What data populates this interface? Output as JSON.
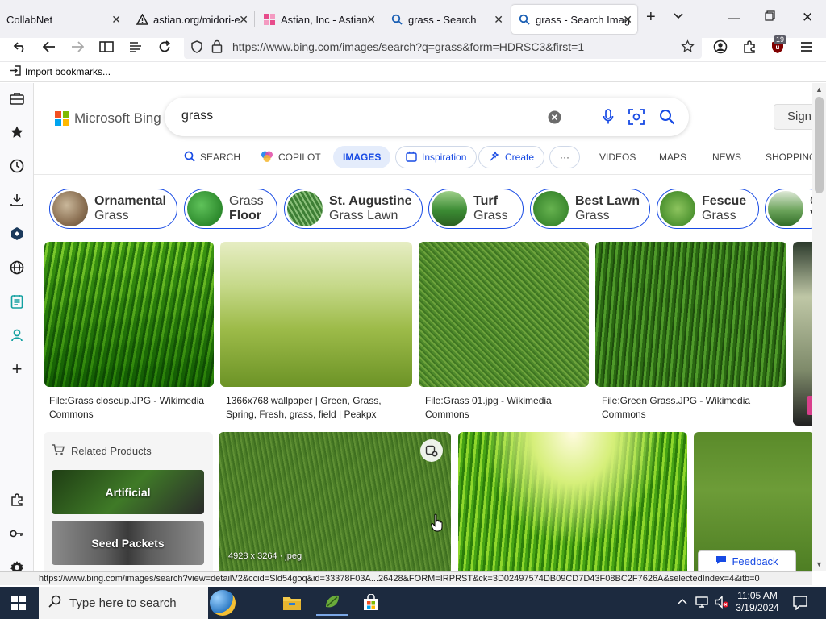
{
  "browser": {
    "tabs": [
      {
        "label": "CollabNet",
        "icon": "none",
        "active": false
      },
      {
        "label": "astian.org/midori-e",
        "icon": "warning-icon",
        "active": false
      },
      {
        "label": "Astian, Inc - Astian",
        "icon": "astian-logo-icon",
        "active": false
      },
      {
        "label": "grass - Search",
        "icon": "search-icon",
        "active": false
      },
      {
        "label": "grass - Search Imag",
        "icon": "search-icon",
        "active": true
      }
    ],
    "url": "https://www.bing.com/images/search?q=grass&form=HDRSC3&first=1",
    "extension_badge": "19",
    "bookmark_label": "Import bookmarks..."
  },
  "bing": {
    "logo_text": "Microsoft Bing",
    "query": "grass",
    "signin_label": "Sign",
    "scopes": [
      {
        "label": "SEARCH",
        "icon": "search-icon"
      },
      {
        "label": "COPILOT",
        "icon": "copilot-icon"
      },
      {
        "label": "IMAGES",
        "icon": "none"
      },
      {
        "label": "Inspiration",
        "icon": "inspiration-icon"
      },
      {
        "label": "Create",
        "icon": "create-icon"
      },
      {
        "label": "···",
        "icon": "more-icon"
      },
      {
        "label": "VIDEOS",
        "icon": "none"
      },
      {
        "label": "MAPS",
        "icon": "none"
      },
      {
        "label": "NEWS",
        "icon": "none"
      },
      {
        "label": "SHOPPING",
        "icon": "none"
      }
    ],
    "chips": [
      {
        "bold": "Ornamental",
        "rest": "Grass",
        "bold_first": true
      },
      {
        "bold": "Floor",
        "rest": "Grass",
        "bold_first": false
      },
      {
        "bold": "St. Augustine",
        "rest": "Grass Lawn",
        "bold_first": true
      },
      {
        "bold": "Turf",
        "rest": "Grass",
        "bold_first": true
      },
      {
        "bold": "Best Lawn",
        "rest": "Grass",
        "bold_first": true
      },
      {
        "bold": "Fescue",
        "rest": "Grass",
        "bold_first": true
      },
      {
        "bold": "Y",
        "rest": "G",
        "bold_first": false
      }
    ],
    "results_row1": [
      {
        "caption": "File:Grass closeup.JPG - Wikimedia Commons"
      },
      {
        "caption": "1366x768 wallpaper | Green, Grass, Spring, Fresh, grass, field | Peakpx"
      },
      {
        "caption": "File:Grass 01.jpg - Wikimedia Commons"
      },
      {
        "caption": "File:Green Grass.JPG - Wikimedia Commons"
      }
    ],
    "related_products": {
      "title": "Related Products",
      "items": [
        "Artificial",
        "Seed Packets"
      ]
    },
    "hover_image_info": "4928 x 3264 · jpeg",
    "feedback_label": "Feedback",
    "status_url": "https://www.bing.com/images/search?view=detailV2&ccid=Sld54goq&id=33378F03A...26428&FORM=IRPRST&ck=3D02497574DB09CD7D43F08BC2F7626A&selectedIndex=4&itb=0"
  },
  "taskbar": {
    "search_placeholder": "Type here to search",
    "time": "11:05 AM",
    "date": "3/19/2024"
  },
  "colors": {
    "accent": "#174ae4",
    "taskbar": "#1c2a3f",
    "tab_strip": "#f0f0f4"
  }
}
